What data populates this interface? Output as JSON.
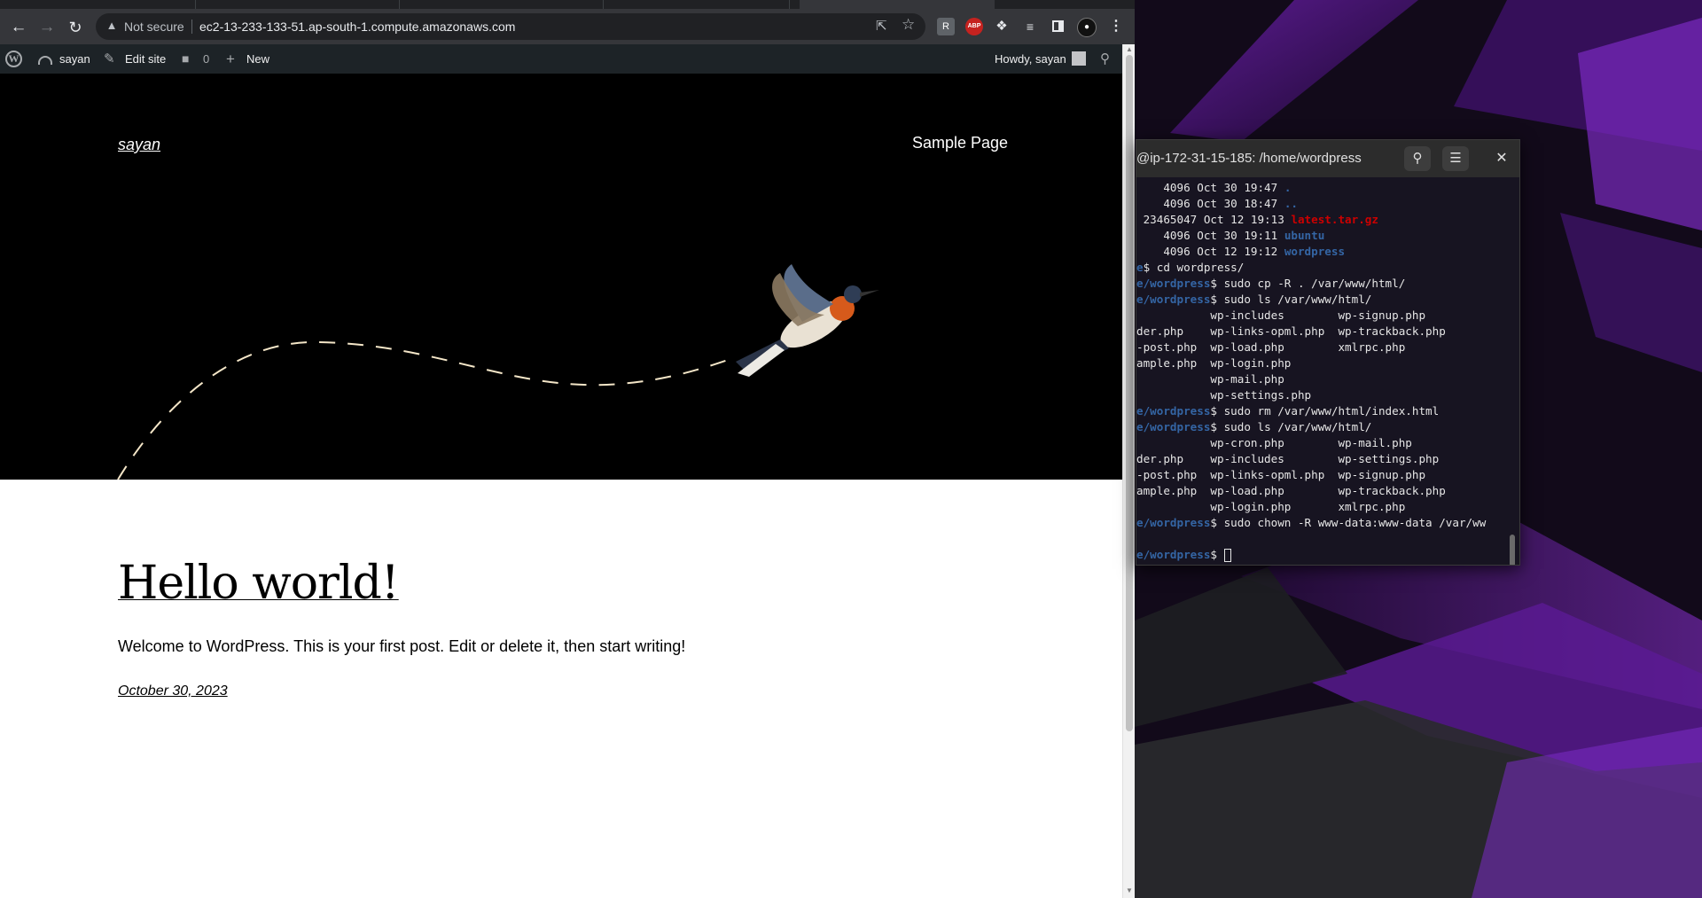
{
  "browser": {
    "omnibox": {
      "security_label": "Not secure",
      "url": "ec2-13-233-133-51.ap-south-1.compute.amazonaws.com"
    },
    "extensions": [
      {
        "name": "reader-icon",
        "label": "R"
      },
      {
        "name": "adblock-plus-icon",
        "label": "ABP"
      },
      {
        "name": "extensions-puzzle-icon",
        "label": ""
      },
      {
        "name": "media-queue-icon",
        "label": ""
      },
      {
        "name": "side-panel-icon",
        "label": ""
      },
      {
        "name": "profile-avatar-icon",
        "label": ""
      },
      {
        "name": "kebab-menu-icon",
        "label": ""
      }
    ]
  },
  "wp_admin_bar": {
    "site_name": "sayan",
    "edit_site": "Edit site",
    "comments_count": "0",
    "new_label": "New",
    "howdy": "Howdy, sayan"
  },
  "site": {
    "title": "sayan",
    "nav_item": "Sample Page",
    "post": {
      "title": "Hello world!",
      "excerpt": "Welcome to WordPress. This is your first post. Edit or delete it, then start writing!",
      "date": "October 30, 2023"
    }
  },
  "terminal": {
    "title": "@ip-172-31-15-185: /home/wordpress",
    "lines": [
      [
        {
          "t": "    4096 Oct 30 19:47 "
        },
        {
          "t": ".",
          "c": "c-blue"
        }
      ],
      [
        {
          "t": "    4096 Oct 30 18:47 "
        },
        {
          "t": "..",
          "c": "c-blue"
        }
      ],
      [
        {
          "t": " 23465047 Oct 12 19:13 "
        },
        {
          "t": "latest.tar.gz",
          "c": "c-red"
        }
      ],
      [
        {
          "t": "    4096 Oct 30 19:11 "
        },
        {
          "t": "ubuntu",
          "c": "c-blue"
        }
      ],
      [
        {
          "t": "    4096 Oct 12 19:12 "
        },
        {
          "t": "wordpress",
          "c": "c-blue"
        }
      ],
      [
        {
          "t": "e",
          "c": "c-ptr"
        },
        {
          "t": "$ cd wordpress/"
        }
      ],
      [
        {
          "t": "e/wordpress",
          "c": "c-ptr"
        },
        {
          "t": "$ sudo cp -R . /var/www/html/"
        }
      ],
      [
        {
          "t": "e/wordpress",
          "c": "c-ptr"
        },
        {
          "t": "$ sudo ls /var/www/html/"
        }
      ],
      [
        {
          "t": "           wp-includes        wp-signup.php"
        }
      ],
      [
        {
          "t": "der.php    wp-links-opml.php  wp-trackback.php"
        }
      ],
      [
        {
          "t": "-post.php  wp-load.php        xmlrpc.php"
        }
      ],
      [
        {
          "t": "ample.php  wp-login.php"
        }
      ],
      [
        {
          "t": "           wp-mail.php"
        }
      ],
      [
        {
          "t": "           wp-settings.php"
        }
      ],
      [
        {
          "t": "e/wordpress",
          "c": "c-ptr"
        },
        {
          "t": "$ sudo rm /var/www/html/index.html"
        }
      ],
      [
        {
          "t": "e/wordpress",
          "c": "c-ptr"
        },
        {
          "t": "$ sudo ls /var/www/html/"
        }
      ],
      [
        {
          "t": "           wp-cron.php        wp-mail.php"
        }
      ],
      [
        {
          "t": "der.php    wp-includes        wp-settings.php"
        }
      ],
      [
        {
          "t": "-post.php  wp-links-opml.php  wp-signup.php"
        }
      ],
      [
        {
          "t": "ample.php  wp-load.php        wp-trackback.php"
        }
      ],
      [
        {
          "t": "           wp-login.php       xmlrpc.php"
        }
      ],
      [
        {
          "t": "e/wordpress",
          "c": "c-ptr"
        },
        {
          "t": "$ sudo chown -R www-data:www-data /var/ww"
        }
      ],
      [
        {
          "t": ""
        }
      ],
      [
        {
          "t": "e/wordpress",
          "c": "c-ptr"
        },
        {
          "t": "$ "
        },
        {
          "cursor": true
        }
      ]
    ]
  }
}
